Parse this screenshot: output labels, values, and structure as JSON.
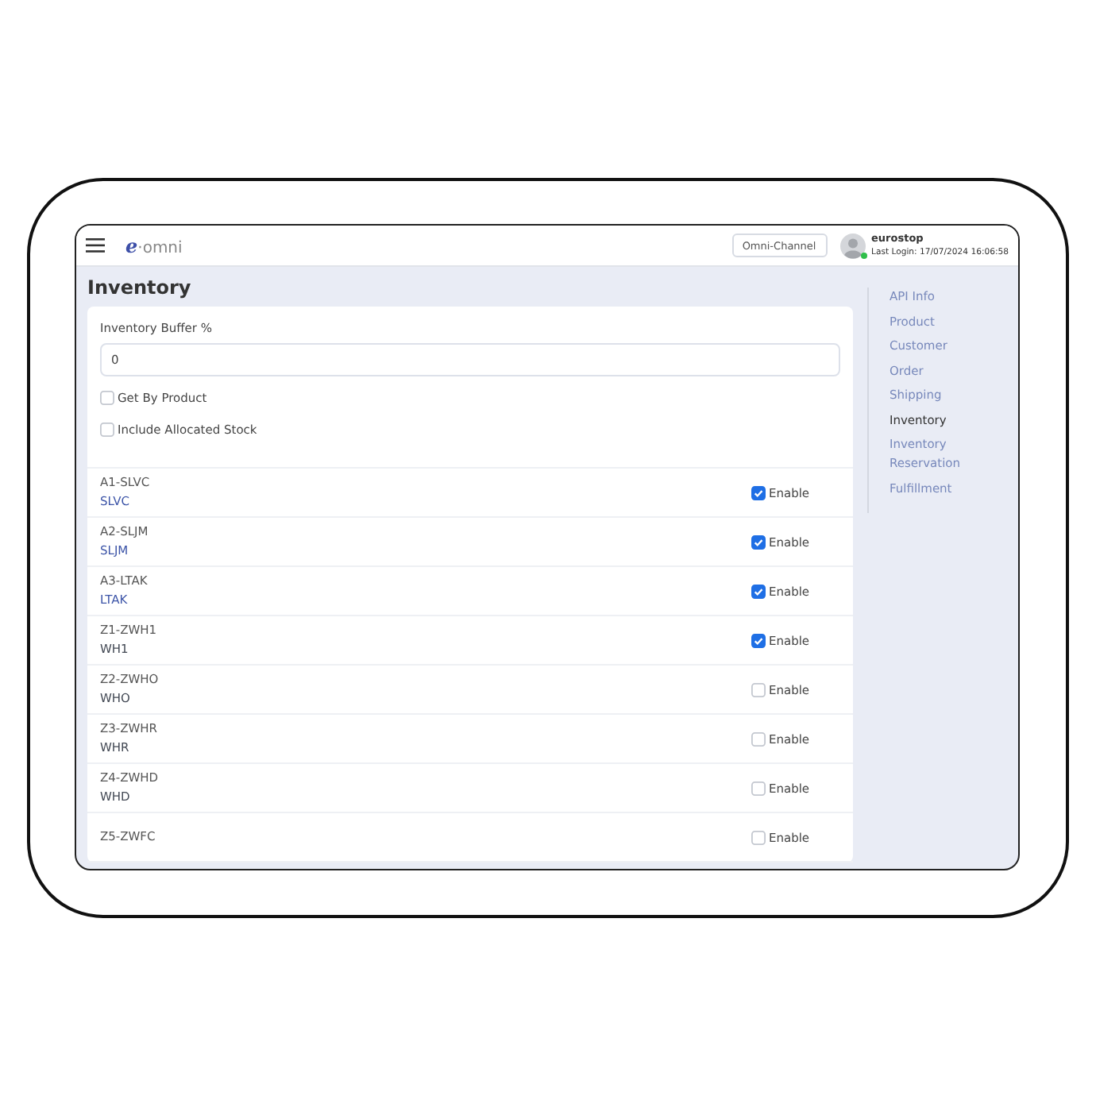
{
  "topbar": {
    "logo_mark": "e",
    "logo_text": "·omni",
    "channel": "Omni-Channel",
    "user": {
      "name": "eurostop",
      "last_login": "Last Login: 17/07/2024 16:06:58",
      "online": true
    }
  },
  "page_title": "Inventory",
  "settings": {
    "buffer_label": "Inventory Buffer %",
    "buffer_value": "0",
    "options": [
      {
        "label": "Get By Product",
        "checked": false
      },
      {
        "label": "Include Allocated Stock",
        "checked": false
      }
    ]
  },
  "locations": [
    {
      "name": "A1-SLVC",
      "code": "SLVC",
      "color": "#3d55a8",
      "label": "Enable",
      "checked": true
    },
    {
      "name": "A2-SLJM",
      "code": "SLJM",
      "color": "#3d55a8",
      "label": "Enable",
      "checked": true
    },
    {
      "name": "A3-LTAK",
      "code": "LTAK",
      "color": "#3d55a8",
      "label": "Enable",
      "checked": true
    },
    {
      "name": "Z1-ZWH1",
      "code": "WH1",
      "color": "#444a55",
      "label": "Enable",
      "checked": true
    },
    {
      "name": "Z2-ZWHO",
      "code": "WHO",
      "color": "#444a55",
      "label": "Enable",
      "checked": false
    },
    {
      "name": "Z3-ZWHR",
      "code": "WHR",
      "color": "#444a55",
      "label": "Enable",
      "checked": false
    },
    {
      "name": "Z4-ZWHD",
      "code": "WHD",
      "color": "#444a55",
      "label": "Enable",
      "checked": false
    },
    {
      "name": "Z5-ZWFC",
      "label": "Enable",
      "checked": false
    }
  ],
  "sidebar": {
    "items": [
      {
        "label": "API Info",
        "selected": false
      },
      {
        "label": "Product",
        "selected": false
      },
      {
        "label": "Customer",
        "selected": false
      },
      {
        "label": "Order",
        "selected": false
      },
      {
        "label": "Shipping",
        "selected": false
      },
      {
        "label": "Inventory",
        "selected": true
      },
      {
        "label": "Inventory Reservation",
        "selected": false
      },
      {
        "label": "Fulfillment",
        "selected": false
      }
    ]
  }
}
